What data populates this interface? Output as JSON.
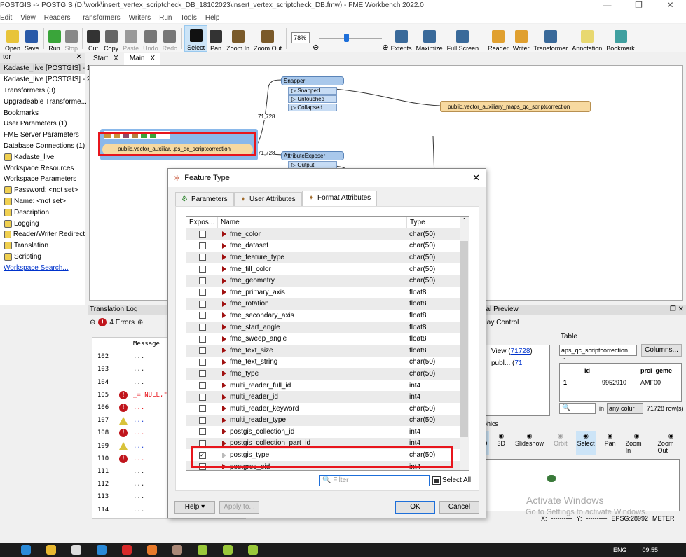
{
  "window": {
    "title": "POSTGIS -> POSTGIS (D:\\work\\insert_vertex_scriptcheck_DB_18102023\\insert_vertex_scriptcheck_DB.fmw) - FME Workbench 2022.0",
    "minimize": "—",
    "maximize": "❐",
    "close": "✕"
  },
  "menu": [
    "Edit",
    "View",
    "Readers",
    "Transformers",
    "Writers",
    "Run",
    "Tools",
    "Help"
  ],
  "toolbar": {
    "buttons": [
      {
        "label": "Open",
        "icon": "folder-icon",
        "color": "#e8c43a"
      },
      {
        "label": "Save",
        "icon": "save-icon",
        "color": "#2a5aa8"
      },
      {
        "label": "Run",
        "icon": "play-icon",
        "color": "#3aa53a"
      },
      {
        "label": "Stop",
        "icon": "stop-icon",
        "color": "#888888"
      },
      {
        "label": "Cut",
        "icon": "scissors-icon",
        "color": "#333333"
      },
      {
        "label": "Copy",
        "icon": "copy-icon",
        "color": "#666666"
      },
      {
        "label": "Paste",
        "icon": "paste-icon",
        "color": "#999999"
      },
      {
        "label": "Undo",
        "icon": "undo-icon",
        "color": "#777777"
      },
      {
        "label": "Redo",
        "icon": "redo-icon",
        "color": "#777777"
      },
      {
        "label": "Select",
        "icon": "cursor-icon",
        "color": "#111111"
      },
      {
        "label": "Pan",
        "icon": "hand-icon",
        "color": "#333333"
      },
      {
        "label": "Zoom In",
        "icon": "zoom-in-icon",
        "color": "#7a5a2a"
      },
      {
        "label": "Zoom Out",
        "icon": "zoom-out-icon",
        "color": "#7a5a2a"
      }
    ],
    "zoom_value": "78%",
    "zoom_level_percent": 78,
    "buttons2": [
      {
        "label": "Extents",
        "icon": "extents-icon",
        "color": "#3a6a9a"
      },
      {
        "label": "Maximize",
        "icon": "maximize-icon",
        "color": "#3a6a9a"
      },
      {
        "label": "Full Screen",
        "icon": "fullscreen-icon",
        "color": "#3a6a9a"
      },
      {
        "label": "Reader",
        "icon": "reader-icon",
        "color": "#e0a030"
      },
      {
        "label": "Writer",
        "icon": "writer-icon",
        "color": "#e0a030"
      },
      {
        "label": "Transformer",
        "icon": "transformer-icon",
        "color": "#3a6a9a"
      },
      {
        "label": "Annotation",
        "icon": "annotation-icon",
        "color": "#e8d870"
      },
      {
        "label": "Bookmark",
        "icon": "bookmark-icon",
        "color": "#40a0a0"
      }
    ]
  },
  "navigator": {
    "title": "tor",
    "items": [
      {
        "label": "Kadaste_live [POSTGIS] - 1",
        "selected": true
      },
      {
        "label": "Kadaste_live [POSTGIS] - 2"
      },
      {
        "label": "Transformers (3)"
      },
      {
        "label": "Upgradeable Transforme..."
      },
      {
        "label": "Bookmarks"
      },
      {
        "label": "User Parameters (1)"
      },
      {
        "label": "FME Server Parameters"
      },
      {
        "label": "Database Connections (1)"
      },
      {
        "label": "Kadaste_live",
        "indent": true
      },
      {
        "label": "Workspace Resources"
      },
      {
        "label": "Workspace Parameters"
      },
      {
        "label": "Password: <not set>",
        "indent": true
      },
      {
        "label": "Name: <not set>",
        "indent": true
      },
      {
        "label": "Description",
        "indent": true
      },
      {
        "label": "Logging",
        "indent": true
      },
      {
        "label": "Reader/Writer Redirect",
        "indent": true
      },
      {
        "label": "Translation",
        "indent": true
      },
      {
        "label": "Scripting",
        "indent": true
      }
    ],
    "search_link": "Workspace Search..."
  },
  "tabs": [
    {
      "label": "Start",
      "close": "X"
    },
    {
      "label": "Main",
      "close": "X",
      "active": true
    }
  ],
  "canvas": {
    "reader_label": "public.vector_auxiliar...ps_qc_scriptcorrection",
    "count1": "71,728",
    "count2": "71,728",
    "snapper": {
      "title": "Snapper",
      "ports": [
        "Snapped",
        "Untouched",
        "Collapsed"
      ]
    },
    "exposer": {
      "title": "AttributeExposer",
      "ports": [
        "Output"
      ]
    },
    "writer_label": "public.vector_auxiliary_maps_qc_scriptcorrection"
  },
  "log": {
    "title": "Translation Log",
    "errors": "4 Errors",
    "header": "Message",
    "rows": [
      {
        "n": "102",
        "m": "...",
        "t": ""
      },
      {
        "n": "103",
        "m": "...",
        "t": ""
      },
      {
        "n": "104",
        "m": "...",
        "t": ""
      },
      {
        "n": "105",
        "m": "_= NULL,\"pro",
        "t": "error"
      },
      {
        "n": "106",
        "m": "...",
        "t": "error"
      },
      {
        "n": "107",
        "m": "...",
        "t": "warn"
      },
      {
        "n": "108",
        "m": "...",
        "t": "error"
      },
      {
        "n": "109",
        "m": "...",
        "t": "warn"
      },
      {
        "n": "110",
        "m": "...",
        "t": "error"
      },
      {
        "n": "111",
        "m": "...",
        "t": ""
      },
      {
        "n": "112",
        "m": "...",
        "t": ""
      },
      {
        "n": "113",
        "m": "...",
        "t": ""
      },
      {
        "n": "114",
        "m": "...",
        "t": ""
      }
    ]
  },
  "preview": {
    "title": "sual Preview",
    "display_control": "splay Control",
    "view_label": "View (",
    "view_count": "71728",
    "view_close": ")",
    "publ_label": "publ... (",
    "publ_count": "71",
    "table_label": "Table",
    "table_select": "aps_qc_scriptcorrection",
    "columns_btn": "Columns...",
    "col_id": "id",
    "col_prcl": "prcl_geme",
    "row_num": "1",
    "row_id": "9952910",
    "row_prcl": "AMF00",
    "in_label": "in",
    "column_select": "any colur",
    "rows_count": "71728 row(s)",
    "graphics_label": "raphics",
    "gbuttons": [
      "2D",
      "3D",
      "Slideshow",
      "Orbit",
      "Select",
      "Pan",
      "Zoom In",
      "Zoom Out"
    ],
    "x_label": "X:",
    "x_val": "----------",
    "y_label": "Y:",
    "y_val": "----------",
    "epsg": "EPSG:28992",
    "unit": "METER",
    "watermark1": "Activate Windows",
    "watermark2": "Go to Settings to activate Windows."
  },
  "dialog": {
    "title": "Feature Type",
    "close": "✕",
    "tabs": [
      {
        "label": "Parameters"
      },
      {
        "label": "User Attributes"
      },
      {
        "label": "Format Attributes",
        "active": true
      }
    ],
    "columns": [
      "Expos...",
      "Name",
      "Type"
    ],
    "rows": [
      {
        "name": "fme_color",
        "type": "char(50)",
        "checked": false
      },
      {
        "name": "fme_dataset",
        "type": "char(50)",
        "checked": false
      },
      {
        "name": "fme_feature_type",
        "type": "char(50)",
        "checked": false
      },
      {
        "name": "fme_fill_color",
        "type": "char(50)",
        "checked": false
      },
      {
        "name": "fme_geometry",
        "type": "char(50)",
        "checked": false
      },
      {
        "name": "fme_primary_axis",
        "type": "float8",
        "checked": false
      },
      {
        "name": "fme_rotation",
        "type": "float8",
        "checked": false
      },
      {
        "name": "fme_secondary_axis",
        "type": "float8",
        "checked": false
      },
      {
        "name": "fme_start_angle",
        "type": "float8",
        "checked": false
      },
      {
        "name": "fme_sweep_angle",
        "type": "float8",
        "checked": false
      },
      {
        "name": "fme_text_size",
        "type": "float8",
        "checked": false
      },
      {
        "name": "fme_text_string",
        "type": "char(50)",
        "checked": false
      },
      {
        "name": "fme_type",
        "type": "char(50)",
        "checked": false
      },
      {
        "name": "multi_reader_full_id",
        "type": "int4",
        "checked": false
      },
      {
        "name": "multi_reader_id",
        "type": "int4",
        "checked": false
      },
      {
        "name": "multi_reader_keyword",
        "type": "char(50)",
        "checked": false
      },
      {
        "name": "multi_reader_type",
        "type": "char(50)",
        "checked": false
      },
      {
        "name": "postgis_collection_id",
        "type": "int4",
        "checked": false
      },
      {
        "name": "postgis_collection_part_id",
        "type": "int4",
        "checked": false
      },
      {
        "name": "postgis_type",
        "type": "char(50)",
        "checked": true
      },
      {
        "name": "postgres_oid",
        "type": "int4",
        "checked": false
      }
    ],
    "filter_placeholder": "Filter",
    "select_all": "Select All",
    "help": "Help",
    "apply": "Apply to...",
    "ok": "OK",
    "cancel": "Cancel"
  },
  "taskbar": {
    "time": "09:55",
    "lang": "ENG"
  },
  "colors": {
    "highlight": "#e8151c",
    "transformer": "#a9c8eb",
    "reader": "#f7d9a0",
    "error": "#c0151c"
  }
}
